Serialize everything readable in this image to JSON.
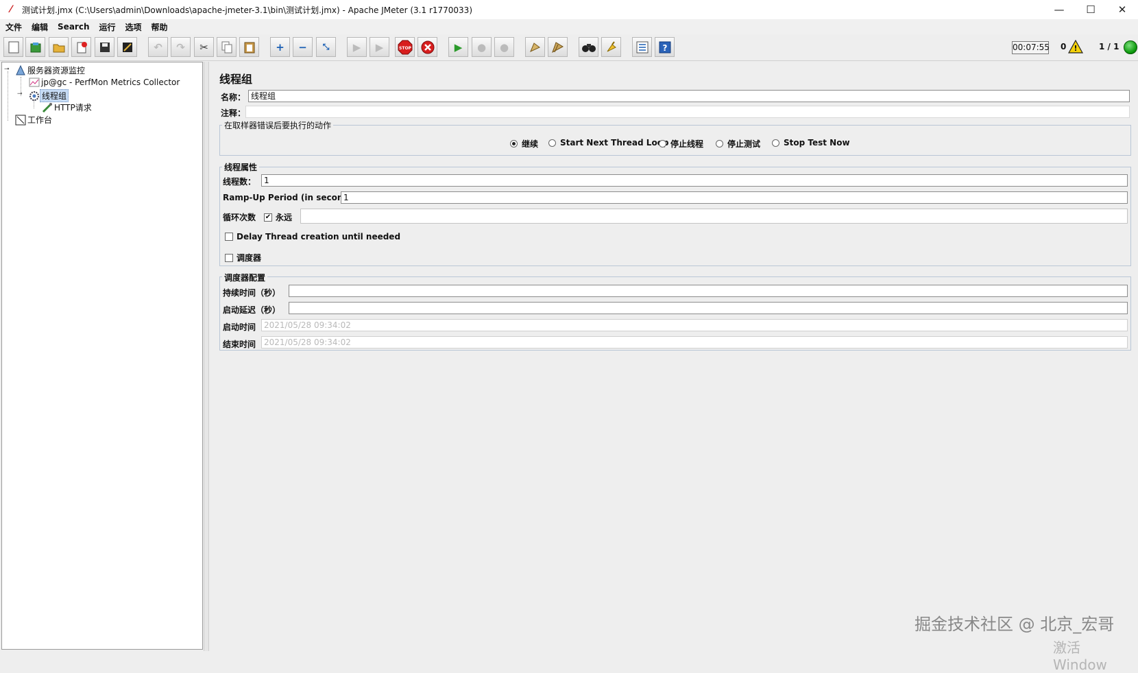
{
  "window": {
    "title": "测试计划.jmx (C:\\Users\\admin\\Downloads\\apache-jmeter-3.1\\bin\\测试计划.jmx) - Apache JMeter (3.1 r1770033)",
    "minimize": "—",
    "maximize": "☐",
    "close": "✕"
  },
  "menu": [
    "文件",
    "编辑",
    "Search",
    "运行",
    "选项",
    "帮助"
  ],
  "status": {
    "timer": "00:07:55",
    "error_count": "0",
    "threads": "1 / 1"
  },
  "tree": {
    "root": "服务器资源监控",
    "collector": "jp@gc - PerfMon Metrics Collector",
    "thread_group": "线程组",
    "http_request": "HTTP请求",
    "workbench": "工作台"
  },
  "panel": {
    "title": "线程组",
    "name_label": "名称：",
    "name_value": "线程组",
    "comment_label": "注释：",
    "comment_value": "",
    "error_action": {
      "title": "在取样器错误后要执行的动作",
      "options": [
        "继续",
        "Start Next Thread Loop",
        "停止线程",
        "停止测试",
        "Stop Test Now"
      ],
      "selected": "继续"
    },
    "thread_props": {
      "title": "线程属性",
      "threads_label": "线程数：",
      "threads_value": "1",
      "rampup_label": "Ramp-Up Period (in seconds):",
      "rampup_value": "1",
      "loop_label": "循环次数",
      "forever_label": "永远",
      "forever_checked": true,
      "loop_value": "",
      "delay_label": "Delay Thread creation until needed",
      "delay_checked": false,
      "scheduler_label": "调度器",
      "scheduler_checked": false
    },
    "scheduler": {
      "title": "调度器配置",
      "duration_label": "持续时间（秒）",
      "duration_value": "",
      "delay_label": "启动延迟（秒）",
      "delay_value": "",
      "start_label": "启动时间",
      "start_value": "2021/05/28 09:34:02",
      "end_label": "结束时间",
      "end_value": "2021/05/28 09:34:02"
    }
  },
  "watermark": "掘金技术社区 @ 北京_宏哥",
  "activate_text": "激活 Window"
}
